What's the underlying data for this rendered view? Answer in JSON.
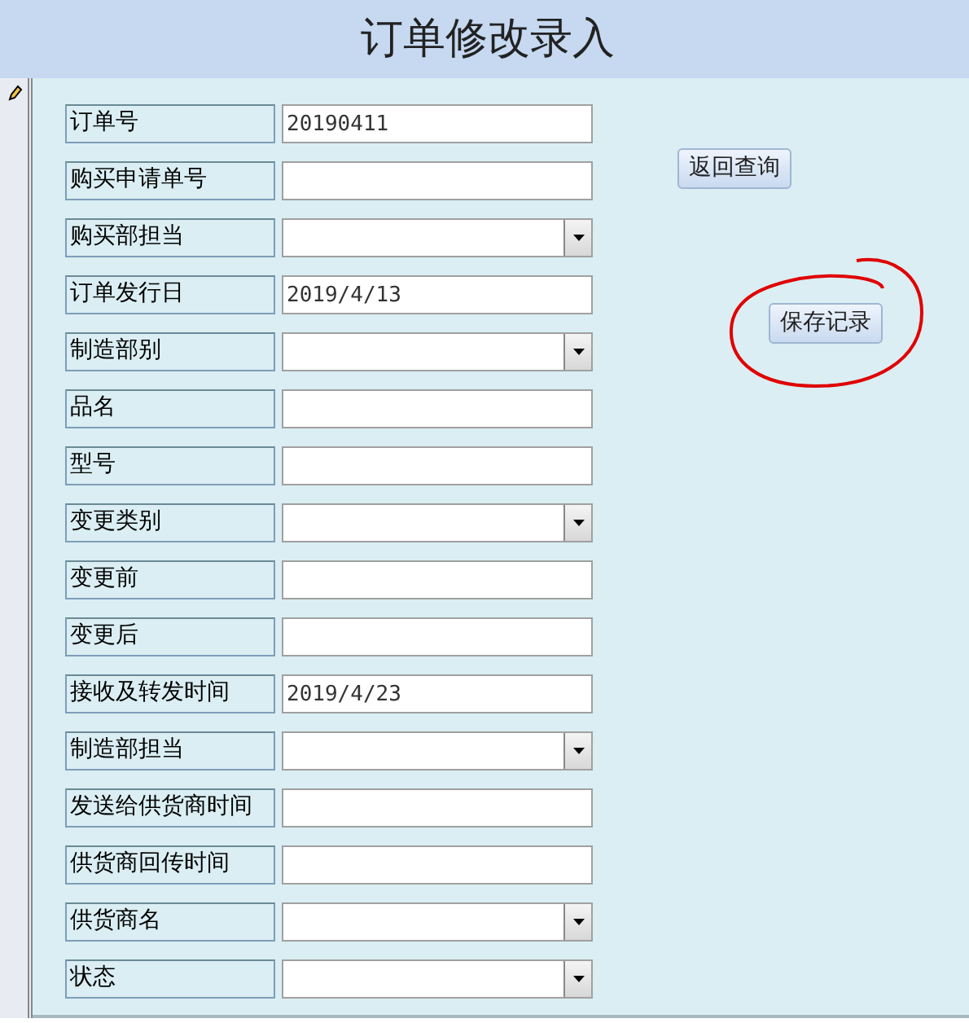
{
  "title": "订单修改录入",
  "fields": [
    {
      "label": "订单号",
      "kind": "text",
      "value": "20190411"
    },
    {
      "label": "购买申请单号",
      "kind": "text"
    },
    {
      "label": "购买部担当",
      "kind": "dropdown"
    },
    {
      "label": "订单发行日",
      "kind": "text",
      "value": "2019/4/13"
    },
    {
      "label": "制造部别",
      "kind": "dropdown"
    },
    {
      "label": "品名",
      "kind": "text"
    },
    {
      "label": "型号",
      "kind": "text"
    },
    {
      "label": "变更类别",
      "kind": "dropdown"
    },
    {
      "label": "变更前",
      "kind": "text"
    },
    {
      "label": "变更后",
      "kind": "text"
    },
    {
      "label": "接收及转发时间",
      "kind": "text",
      "value": "2019/4/23"
    },
    {
      "label": "制造部担当",
      "kind": "dropdown"
    },
    {
      "label": "发送给供货商时间",
      "kind": "text"
    },
    {
      "label": "供货商回传时间",
      "kind": "text"
    },
    {
      "label": "供货商名",
      "kind": "dropdown"
    },
    {
      "label": "状态",
      "kind": "dropdown"
    }
  ],
  "buttons": [
    {
      "label": "返回查询",
      "circled": false
    },
    {
      "label": "保存记录",
      "circled": true
    }
  ]
}
